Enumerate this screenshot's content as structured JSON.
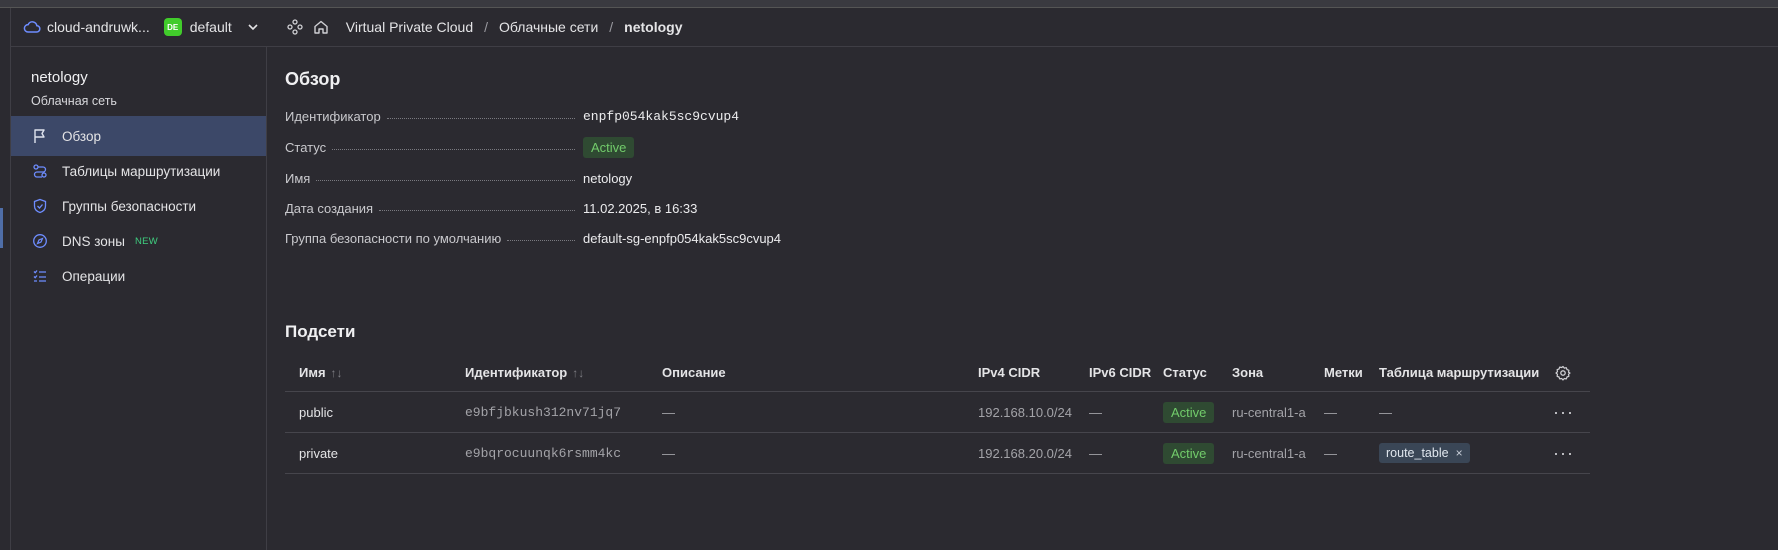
{
  "header": {
    "cloud_name": "cloud-andruwk...",
    "folder_badge": "DE",
    "folder_name": "default",
    "breadcrumbs": [
      "Virtual Private Cloud",
      "Облачные сети",
      "netology"
    ]
  },
  "sidebar": {
    "title": "netology",
    "subtitle": "Облачная сеть",
    "items": [
      {
        "label": "Обзор",
        "icon": "flag-icon",
        "active": true
      },
      {
        "label": "Таблицы маршрутизации",
        "icon": "route-icon"
      },
      {
        "label": "Группы безопасности",
        "icon": "shield-icon"
      },
      {
        "label": "DNS зоны",
        "icon": "compass-icon",
        "badge": "NEW"
      },
      {
        "label": "Операции",
        "icon": "operations-list-icon"
      }
    ]
  },
  "overview": {
    "title": "Обзор",
    "fields": {
      "id_label": "Идентификатор",
      "id_value": "enpfp054kak5sc9cvup4",
      "status_label": "Статус",
      "status_value": "Active",
      "name_label": "Имя",
      "name_value": "netology",
      "created_label": "Дата создания",
      "created_value": "11.02.2025, в 16:33",
      "sg_label": "Группа безопасности по умолчанию",
      "sg_value": "default-sg-enpfp054kak5sc9cvup4"
    }
  },
  "subnets": {
    "title": "Подсети",
    "columns": [
      "Имя",
      "Идентификатор",
      "Описание",
      "IPv4 CIDR",
      "IPv6 CIDR",
      "Статус",
      "Зона",
      "Метки",
      "Таблица маршрутизации"
    ],
    "sort_glyph": "↑↓",
    "rows": [
      {
        "name": "public",
        "id": "e9bfjbkush312nv71jq7",
        "description": "—",
        "ipv4": "192.168.10.0/24",
        "ipv6": "—",
        "status": "Active",
        "zone": "ru-central1-a",
        "labels": "—",
        "route_table": "—",
        "actions": "···"
      },
      {
        "name": "private",
        "id": "e9bqrocuunqk6rsmm4kc",
        "description": "—",
        "ipv4": "192.168.20.0/24",
        "ipv6": "—",
        "status": "Active",
        "zone": "ru-central1-a",
        "labels": "—",
        "route_table": "route_table",
        "route_table_remove": "×",
        "actions": "···"
      }
    ]
  },
  "colors": {
    "background": "#2b2a30",
    "active_nav": "#3c4868",
    "status_bg": "#2f4a32",
    "status_text": "#72cc6b",
    "link": "#5b8dff",
    "folder_badge": "#41cc2b"
  }
}
